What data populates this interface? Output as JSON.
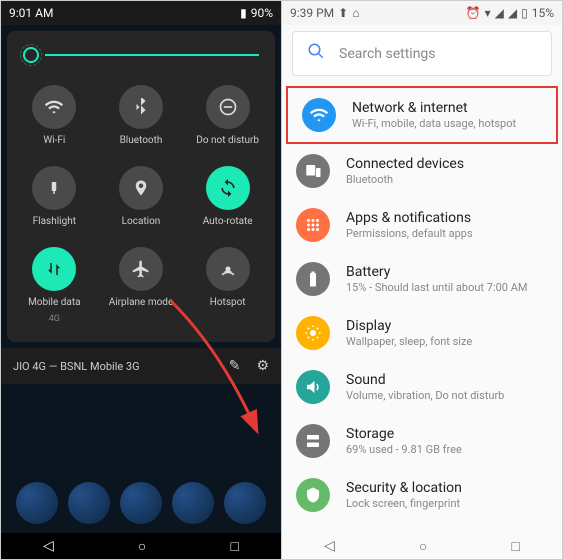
{
  "left": {
    "status": {
      "time": "9:01 AM",
      "battery": "90%"
    },
    "tiles": [
      {
        "label": "Wi-Fi",
        "sub": "",
        "glyph": "wifi",
        "on": false
      },
      {
        "label": "Bluetooth",
        "sub": "",
        "glyph": "bt",
        "on": false
      },
      {
        "label": "Do not disturb",
        "sub": "",
        "glyph": "dnd",
        "on": false
      },
      {
        "label": "Flashlight",
        "sub": "",
        "glyph": "flash",
        "on": false
      },
      {
        "label": "Location",
        "sub": "",
        "glyph": "loc",
        "on": false
      },
      {
        "label": "Auto-rotate",
        "sub": "",
        "glyph": "rotate",
        "on": true
      },
      {
        "label": "Mobile data",
        "sub": "4G",
        "glyph": "data",
        "on": true
      },
      {
        "label": "Airplane mode",
        "sub": "",
        "glyph": "plane",
        "on": false
      },
      {
        "label": "Hotspot",
        "sub": "",
        "glyph": "hotspot",
        "on": false
      }
    ],
    "footer": "JIO 4G — BSNL Mobile 3G"
  },
  "right": {
    "status": {
      "time": "9:39 PM",
      "battery": "15%"
    },
    "search_placeholder": "Search settings",
    "items": [
      {
        "title": "Network & internet",
        "sub": "Wi-Fi, mobile, data usage, hotspot",
        "glyph": "wifi",
        "color": "#2196f3",
        "hl": true
      },
      {
        "title": "Connected devices",
        "sub": "Bluetooth",
        "glyph": "devices",
        "color": "#757575",
        "hl": false
      },
      {
        "title": "Apps & notifications",
        "sub": "Permissions, default apps",
        "glyph": "apps",
        "color": "#ff7043",
        "hl": false
      },
      {
        "title": "Battery",
        "sub": "15% - Should last until about 7:00 AM",
        "glyph": "battery",
        "color": "#757575",
        "hl": false
      },
      {
        "title": "Display",
        "sub": "Wallpaper, sleep, font size",
        "glyph": "display",
        "color": "#ffb300",
        "hl": false
      },
      {
        "title": "Sound",
        "sub": "Volume, vibration, Do not disturb",
        "glyph": "sound",
        "color": "#26a69a",
        "hl": false
      },
      {
        "title": "Storage",
        "sub": "69% used - 9.81 GB free",
        "glyph": "storage",
        "color": "#757575",
        "hl": false
      },
      {
        "title": "Security & location",
        "sub": "Lock screen, fingerprint",
        "glyph": "security",
        "color": "#66bb6a",
        "hl": false
      }
    ]
  }
}
